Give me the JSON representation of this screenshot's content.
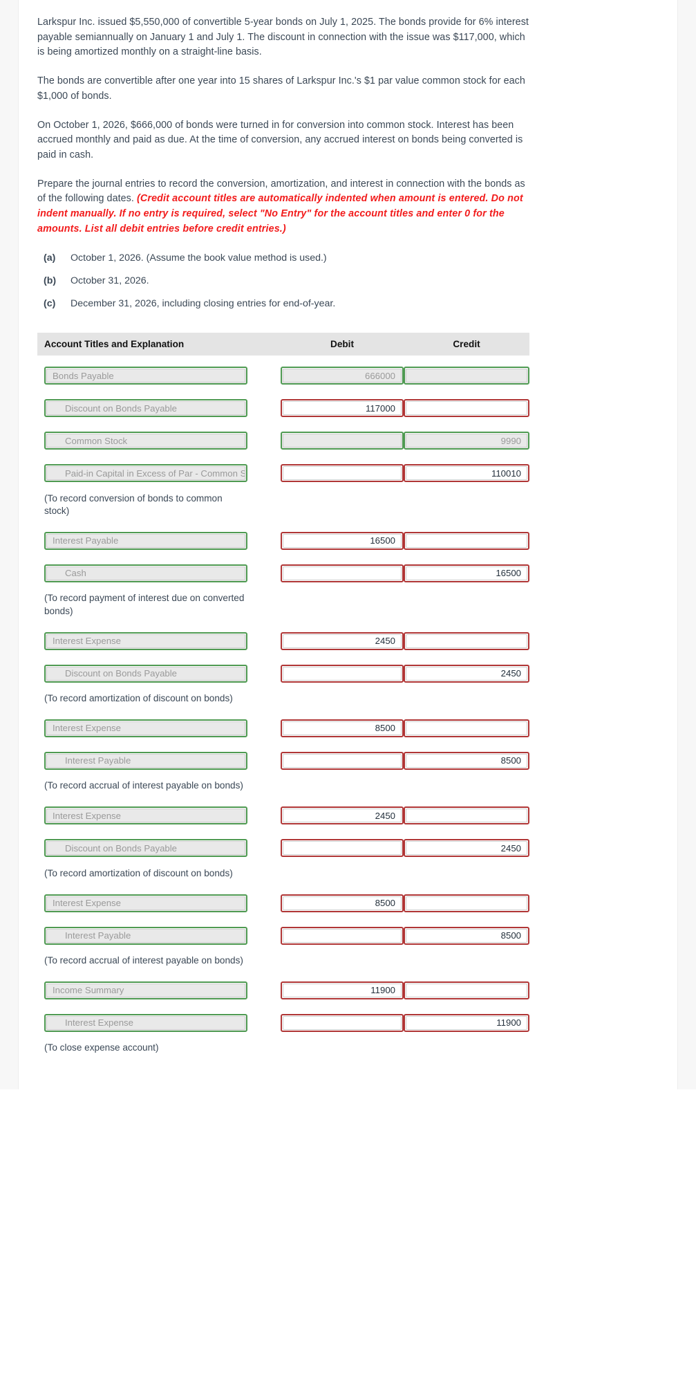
{
  "problem": {
    "paragraphs": [
      "Larkspur Inc. issued $5,550,000 of convertible 5-year bonds on July 1, 2025. The bonds provide for 6% interest payable semiannually on January 1 and July 1. The discount in connection with the issue was $117,000, which is being amortized monthly on a straight-line basis.",
      "The bonds are convertible after one year into 15 shares of Larkspur Inc.'s $1 par value common stock for each $1,000 of bonds.",
      "On October 1, 2026, $666,000 of bonds were turned in for conversion into common stock. Interest has been accrued monthly and paid as due. At the time of conversion, any accrued interest on bonds being converted is paid in cash."
    ],
    "prompt_lead": "Prepare the journal entries to record the conversion, amortization, and interest in connection with the bonds as of the following dates. ",
    "prompt_red": "(Credit account titles are automatically indented when amount is entered. Do not indent manually. If no entry is required, select \"No Entry\" for the account titles and enter 0 for the amounts. List all debit entries before credit entries.)",
    "red_color": "#f21c1c",
    "items": [
      {
        "mark": "(a)",
        "text": "October 1, 2026. (Assume the book value method is used.)"
      },
      {
        "mark": "(b)",
        "text": "October 31, 2026."
      },
      {
        "mark": "(c)",
        "text": "December 31, 2026, including closing entries for end-of-year."
      }
    ]
  },
  "table": {
    "headers": {
      "account": "Account Titles and Explanation",
      "debit": "Debit",
      "credit": "Credit"
    },
    "status_colors": {
      "correct_border": "#4f9a52",
      "incorrect_border": "#b03636"
    },
    "rows": [
      {
        "kind": "entry",
        "account": "Bonds Payable",
        "account_state": "ok",
        "indent": false,
        "debit": "666000",
        "debit_state": "ok",
        "credit": "",
        "credit_state": "ok"
      },
      {
        "kind": "entry",
        "account": "Discount on Bonds Payable",
        "account_state": "ok",
        "indent": true,
        "debit": "117000",
        "debit_state": "err",
        "credit": "",
        "credit_state": "err"
      },
      {
        "kind": "entry",
        "account": "Common Stock",
        "account_state": "ok",
        "indent": true,
        "debit": "",
        "debit_state": "ok",
        "credit": "9990",
        "credit_state": "ok"
      },
      {
        "kind": "entry",
        "account": "Paid-in Capital in Excess of Par - Common Stock",
        "account_state": "ok",
        "indent": true,
        "debit": "",
        "debit_state": "err",
        "credit": "110010",
        "credit_state": "err"
      },
      {
        "kind": "note",
        "text": "(To record conversion of bonds to common stock)"
      },
      {
        "kind": "entry",
        "account": "Interest Payable",
        "account_state": "ok",
        "indent": false,
        "debit": "16500",
        "debit_state": "err",
        "credit": "",
        "credit_state": "err"
      },
      {
        "kind": "entry",
        "account": "Cash",
        "account_state": "ok",
        "indent": true,
        "debit": "",
        "debit_state": "err",
        "credit": "16500",
        "credit_state": "err"
      },
      {
        "kind": "note",
        "text": "(To record payment of interest due on converted bonds)"
      },
      {
        "kind": "entry",
        "account": "Interest Expense",
        "account_state": "ok",
        "indent": false,
        "debit": "2450",
        "debit_state": "err",
        "credit": "",
        "credit_state": "err"
      },
      {
        "kind": "entry",
        "account": "Discount on Bonds Payable",
        "account_state": "ok",
        "indent": true,
        "debit": "",
        "debit_state": "err",
        "credit": "2450",
        "credit_state": "err"
      },
      {
        "kind": "note",
        "text": "(To record amortization of discount on bonds)"
      },
      {
        "kind": "entry",
        "account": "Interest Expense",
        "account_state": "ok",
        "indent": false,
        "debit": "8500",
        "debit_state": "err",
        "credit": "",
        "credit_state": "err"
      },
      {
        "kind": "entry",
        "account": "Interest Payable",
        "account_state": "ok",
        "indent": true,
        "debit": "",
        "debit_state": "err",
        "credit": "8500",
        "credit_state": "err"
      },
      {
        "kind": "note",
        "text": "(To record accrual of interest payable on bonds)"
      },
      {
        "kind": "entry",
        "account": "Interest Expense",
        "account_state": "ok",
        "indent": false,
        "debit": "2450",
        "debit_state": "err",
        "credit": "",
        "credit_state": "err"
      },
      {
        "kind": "entry",
        "account": "Discount on Bonds Payable",
        "account_state": "ok",
        "indent": true,
        "debit": "",
        "debit_state": "err",
        "credit": "2450",
        "credit_state": "err"
      },
      {
        "kind": "note",
        "text": "(To record amortization of discount on bonds)"
      },
      {
        "kind": "entry",
        "account": "Interest Expense",
        "account_state": "ok",
        "indent": false,
        "debit": "8500",
        "debit_state": "err",
        "credit": "",
        "credit_state": "err"
      },
      {
        "kind": "entry",
        "account": "Interest Payable",
        "account_state": "ok",
        "indent": true,
        "debit": "",
        "debit_state": "err",
        "credit": "8500",
        "credit_state": "err"
      },
      {
        "kind": "note",
        "text": "(To record accrual of interest payable on bonds)"
      },
      {
        "kind": "entry",
        "account": "Income Summary",
        "account_state": "ok",
        "indent": false,
        "debit": "11900",
        "debit_state": "err",
        "credit": "",
        "credit_state": "err"
      },
      {
        "kind": "entry",
        "account": "Interest Expense",
        "account_state": "ok",
        "indent": true,
        "debit": "",
        "debit_state": "err",
        "credit": "11900",
        "credit_state": "err"
      },
      {
        "kind": "note",
        "text": "(To close expense account)"
      }
    ]
  }
}
